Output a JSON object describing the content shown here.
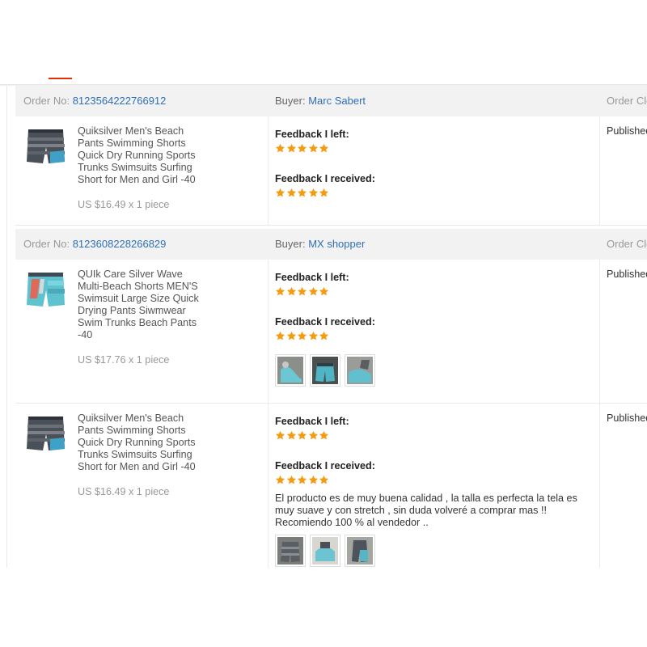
{
  "header": {
    "tabs": [
      {
        "label": "",
        "active": true
      }
    ]
  },
  "orders": [
    {
      "order_no_label": "Order No:",
      "order_no": "8123564222766912",
      "buyer_label": "Buyer:",
      "buyer_name": "Marc Sabert",
      "order_status": "Order Clo",
      "product": {
        "image_icon": "shorts-gray-photo",
        "title": "Quiksilver Men's Beach Pants Swimming Shorts Quick Dry Running Sports Trunks Swimsuits Surfing Short for Men and Girl -40",
        "price_line": "US $16.49 x 1 piece"
      },
      "feedback_left_label": "Feedback I left:",
      "feedback_left_rating": 5,
      "feedback_received_label": "Feedback I received:",
      "feedback_received_rating": 5,
      "status": "Published"
    },
    {
      "order_no_label": "Order No:",
      "order_no": "8123608228266829",
      "buyer_label": "Buyer:",
      "buyer_name": "MX shopper",
      "order_status": "Order Clo",
      "product": {
        "image_icon": "shorts-turquoise-photo",
        "title": "QUIk Care Silver Wave Multi-Beach Shorts MEN'S Swimsuit Large Size Quick Drying Pants Siwmwear Swim Trunks Beach Pants -40",
        "price_line": "US $17.76 x 1 piece"
      },
      "feedback_left_label": "Feedback I left:",
      "feedback_left_rating": 5,
      "feedback_received_label": "Feedback I received:",
      "feedback_received_rating": 5,
      "photos": 3,
      "status": "Published"
    },
    {
      "product": {
        "image_icon": "shorts-gray-photo",
        "title": "Quiksilver Men's Beach Pants Swimming Shorts Quick Dry Running Sports Trunks Swimsuits Surfing Short for Men and Girl -40",
        "price_line": "US $16.49 x 1 piece"
      },
      "feedback_left_label": "Feedback I left:",
      "feedback_left_rating": 5,
      "feedback_received_label": "Feedback I received:",
      "feedback_received_rating": 5,
      "comment": "El producto es de muy buena calidad , la talla es perfecta la tela es muy suave y con stretch , sin duda volveré a comprar mas !! Recomiendo 100 % al vendedor ..",
      "photos": 3,
      "status": "Published"
    }
  ],
  "colors": {
    "link": "#2f6fb7",
    "star": "#f39c12",
    "accent": "#e62e04",
    "header_bg": "#f2f2f2"
  },
  "icons": {
    "star": "star-icon",
    "photo": "review-photo-thumbnail"
  }
}
